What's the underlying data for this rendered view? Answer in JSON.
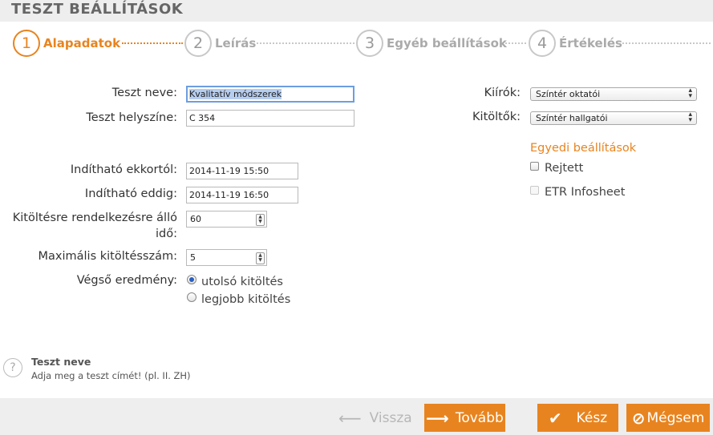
{
  "window": {
    "title": "TESZT BEÁLLÍTÁSOK"
  },
  "steps": [
    {
      "number": "1",
      "label": "Alapadatok",
      "active": true
    },
    {
      "number": "2",
      "label": "Leírás",
      "active": false
    },
    {
      "number": "3",
      "label": "Egyéb beállítások",
      "active": false
    },
    {
      "number": "4",
      "label": "Értékelés",
      "active": false
    }
  ],
  "form": {
    "name_label": "Teszt neve:",
    "name_value": "Kvalitatív módszerek",
    "location_label": "Teszt helyszíne:",
    "location_value": "C 354",
    "start_label": "Indítható ekkortól:",
    "start_value": "2014-11-19 15:50",
    "end_label": "Indítható eddig:",
    "end_value": "2014-11-19 16:50",
    "duration_label_line1": "Kitöltésre rendelkezésre álló",
    "duration_label_line2": "idő:",
    "duration_value": "60",
    "max_attempts_label": "Maximális kitöltésszám:",
    "max_attempts_value": "5",
    "final_result_label": "Végső eredmény:",
    "final_result_options": [
      {
        "label": "utolsó kitöltés",
        "selected": true
      },
      {
        "label": "legjobb kitöltés",
        "selected": false
      }
    ]
  },
  "right": {
    "announcers_label": "Kiírók:",
    "announcers_value": "Színtér oktatói",
    "fillers_label": "Kitöltők:",
    "fillers_value": "Színtér hallgatói",
    "custom_settings_title": "Egyedi beállítások",
    "hidden_label": "Rejtett",
    "etr_label": "ETR Infosheet"
  },
  "help": {
    "icon": "question-icon",
    "title": "Teszt neve",
    "text": "Adja meg a teszt címét! (pl. II. ZH)"
  },
  "footer": {
    "back_label": "Vissza",
    "next_label": "Tovább",
    "done_label": "Kész",
    "cancel_label": "Mégsem"
  },
  "colors": {
    "accent": "#e8841f",
    "inactive": "#c8c8c8",
    "bar_background": "#eeeeee"
  }
}
